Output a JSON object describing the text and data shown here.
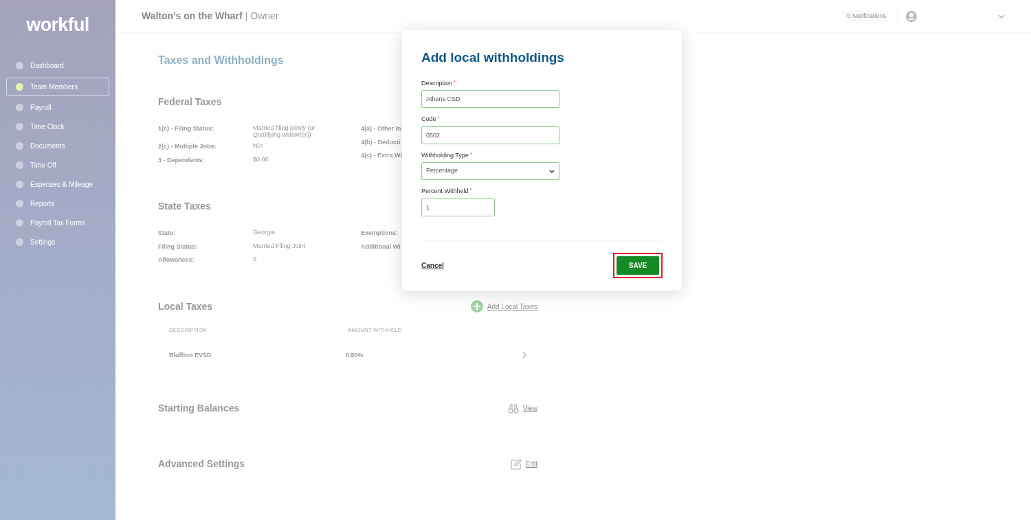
{
  "sidebar": {
    "logo": "workful",
    "items": [
      {
        "label": "Dashboard",
        "selected": false
      },
      {
        "label": "Team Members",
        "selected": true
      },
      {
        "label": "Payroll",
        "selected": false
      },
      {
        "label": "Time Clock",
        "selected": false
      },
      {
        "label": "Documents",
        "selected": false
      },
      {
        "label": "Time Off",
        "selected": false
      },
      {
        "label": "Expenses & Mileage",
        "selected": false
      },
      {
        "label": "Reports",
        "selected": false
      },
      {
        "label": "Payroll Tax Forms",
        "selected": false
      },
      {
        "label": "Settings",
        "selected": false
      }
    ]
  },
  "header": {
    "company": "Walton's on the Wharf",
    "separator": "|",
    "role": "Owner",
    "notifications": "0 Notifications"
  },
  "page": {
    "title": "Taxes and Withholdings",
    "sections": [
      {
        "kind": "fields",
        "title": "Federal Taxes",
        "rows": [
          {
            "label": "1(c) - Filing Status:",
            "value": "Married filing jointly (or Qualifying widow(er))"
          },
          {
            "label": "2(c) - Multiple Jobs:",
            "value": "N/A"
          },
          {
            "label": "3 - Dependents:",
            "value": "$0.00"
          }
        ],
        "side_labels": [
          "4(a) - Other In",
          "4(b) - Deducti",
          "4(c) - Extra Wi"
        ]
      },
      {
        "kind": "fields",
        "title": "State Taxes",
        "rows": [
          {
            "label": "State:",
            "value": "Georgia"
          },
          {
            "label": "Filing Status:",
            "value": "Married Filing Joint"
          },
          {
            "label": "Allowances:",
            "value": "0"
          }
        ],
        "side_labels": [
          "Exemptions:",
          "Additional Wi"
        ]
      },
      {
        "kind": "table",
        "title": "Local Taxes",
        "action": {
          "kind": "add",
          "label": "Add Local Taxes"
        },
        "columns": [
          "DESCRIPTION",
          "AMOUNT WITHHELD"
        ],
        "rows": [
          {
            "cells": [
              "Bluffton EVSD",
              "0.50%"
            ]
          }
        ]
      },
      {
        "kind": "link",
        "title": "Starting Balances",
        "action": {
          "kind": "view",
          "label": "View"
        }
      },
      {
        "kind": "link",
        "title": "Advanced Settings",
        "action": {
          "kind": "edit",
          "label": "Edit"
        }
      }
    ]
  },
  "dialog": {
    "title": "Add local withholdings",
    "fields": [
      {
        "kind": "text",
        "label": "Description",
        "required_mark": "*",
        "value": "Athens CSD"
      },
      {
        "kind": "text",
        "label": "Code",
        "required_mark": "*",
        "value": "0502"
      },
      {
        "kind": "select",
        "label": "Withholding Type",
        "required_mark": "*",
        "value": "Percentage"
      },
      {
        "kind": "number",
        "label": "Percent Withheld",
        "required_mark": "*",
        "value": "1"
      }
    ],
    "cancel": "Cancel",
    "save": {
      "label": "SAVE",
      "highlighted": true
    }
  }
}
